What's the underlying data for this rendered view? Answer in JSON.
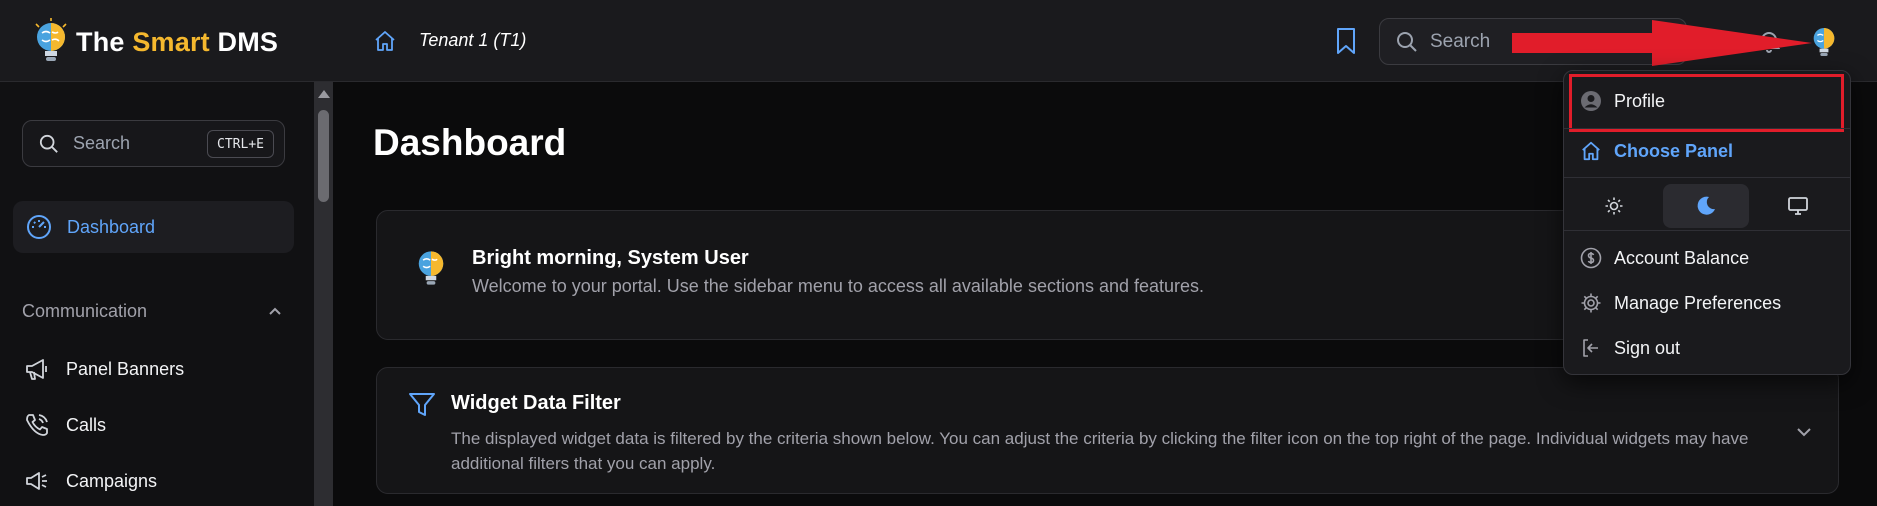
{
  "header": {
    "logo_prefix": "The ",
    "logo_accent": "Smart",
    "logo_suffix": " DMS",
    "tenant": "Tenant 1 (T1)",
    "search_placeholder": "Search"
  },
  "sidebar": {
    "search_placeholder": "Search",
    "search_shortcut": "CTRL+E",
    "active_item": "Dashboard",
    "section_title": "Communication",
    "items": [
      {
        "label": "Panel Banners",
        "icon": "megaphone-icon"
      },
      {
        "label": "Calls",
        "icon": "phone-icon"
      },
      {
        "label": "Campaigns",
        "icon": "campaign-icon"
      }
    ]
  },
  "main": {
    "title": "Dashboard",
    "greeting": {
      "title": "Bright morning, System User",
      "subtitle": "Welcome to your portal. Use the sidebar menu to access all available sections and features."
    },
    "filter": {
      "title": "Widget Data Filter",
      "description": "The displayed widget data is filtered by the criteria shown below. You can adjust the criteria by clicking the filter icon on the top right of the page. Individual widgets may have additional filters that you can apply."
    }
  },
  "user_menu": {
    "profile": "Profile",
    "choose_panel": "Choose Panel",
    "theme_options": [
      "light",
      "dark",
      "system"
    ],
    "theme_selected": "dark",
    "account_balance": "Account Balance",
    "manage_preferences": "Manage Preferences",
    "sign_out": "Sign out"
  },
  "colors": {
    "accent_blue": "#60a5fa",
    "logo_accent": "#f5b82e",
    "annotation_red": "#e11d2a"
  }
}
